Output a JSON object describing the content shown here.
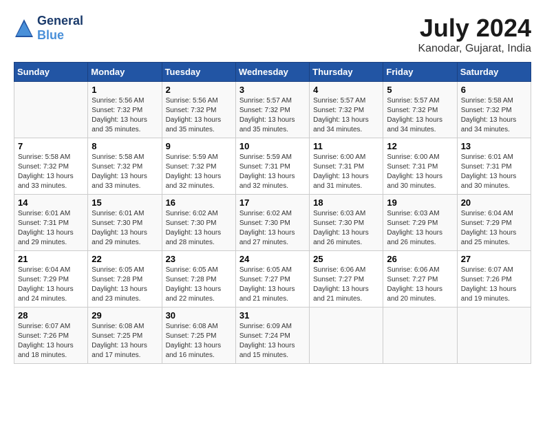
{
  "header": {
    "logo_line1": "General",
    "logo_line2": "Blue",
    "month_year": "July 2024",
    "location": "Kanodar, Gujarat, India"
  },
  "weekdays": [
    "Sunday",
    "Monday",
    "Tuesday",
    "Wednesday",
    "Thursday",
    "Friday",
    "Saturday"
  ],
  "weeks": [
    [
      {
        "day": "",
        "sunrise": "",
        "sunset": "",
        "daylight": ""
      },
      {
        "day": "1",
        "sunrise": "5:56 AM",
        "sunset": "7:32 PM",
        "daylight": "13 hours and 35 minutes."
      },
      {
        "day": "2",
        "sunrise": "5:56 AM",
        "sunset": "7:32 PM",
        "daylight": "13 hours and 35 minutes."
      },
      {
        "day": "3",
        "sunrise": "5:57 AM",
        "sunset": "7:32 PM",
        "daylight": "13 hours and 35 minutes."
      },
      {
        "day": "4",
        "sunrise": "5:57 AM",
        "sunset": "7:32 PM",
        "daylight": "13 hours and 34 minutes."
      },
      {
        "day": "5",
        "sunrise": "5:57 AM",
        "sunset": "7:32 PM",
        "daylight": "13 hours and 34 minutes."
      },
      {
        "day": "6",
        "sunrise": "5:58 AM",
        "sunset": "7:32 PM",
        "daylight": "13 hours and 34 minutes."
      }
    ],
    [
      {
        "day": "7",
        "sunrise": "5:58 AM",
        "sunset": "7:32 PM",
        "daylight": "13 hours and 33 minutes."
      },
      {
        "day": "8",
        "sunrise": "5:58 AM",
        "sunset": "7:32 PM",
        "daylight": "13 hours and 33 minutes."
      },
      {
        "day": "9",
        "sunrise": "5:59 AM",
        "sunset": "7:32 PM",
        "daylight": "13 hours and 32 minutes."
      },
      {
        "day": "10",
        "sunrise": "5:59 AM",
        "sunset": "7:31 PM",
        "daylight": "13 hours and 32 minutes."
      },
      {
        "day": "11",
        "sunrise": "6:00 AM",
        "sunset": "7:31 PM",
        "daylight": "13 hours and 31 minutes."
      },
      {
        "day": "12",
        "sunrise": "6:00 AM",
        "sunset": "7:31 PM",
        "daylight": "13 hours and 30 minutes."
      },
      {
        "day": "13",
        "sunrise": "6:01 AM",
        "sunset": "7:31 PM",
        "daylight": "13 hours and 30 minutes."
      }
    ],
    [
      {
        "day": "14",
        "sunrise": "6:01 AM",
        "sunset": "7:31 PM",
        "daylight": "13 hours and 29 minutes."
      },
      {
        "day": "15",
        "sunrise": "6:01 AM",
        "sunset": "7:30 PM",
        "daylight": "13 hours and 29 minutes."
      },
      {
        "day": "16",
        "sunrise": "6:02 AM",
        "sunset": "7:30 PM",
        "daylight": "13 hours and 28 minutes."
      },
      {
        "day": "17",
        "sunrise": "6:02 AM",
        "sunset": "7:30 PM",
        "daylight": "13 hours and 27 minutes."
      },
      {
        "day": "18",
        "sunrise": "6:03 AM",
        "sunset": "7:30 PM",
        "daylight": "13 hours and 26 minutes."
      },
      {
        "day": "19",
        "sunrise": "6:03 AM",
        "sunset": "7:29 PM",
        "daylight": "13 hours and 26 minutes."
      },
      {
        "day": "20",
        "sunrise": "6:04 AM",
        "sunset": "7:29 PM",
        "daylight": "13 hours and 25 minutes."
      }
    ],
    [
      {
        "day": "21",
        "sunrise": "6:04 AM",
        "sunset": "7:29 PM",
        "daylight": "13 hours and 24 minutes."
      },
      {
        "day": "22",
        "sunrise": "6:05 AM",
        "sunset": "7:28 PM",
        "daylight": "13 hours and 23 minutes."
      },
      {
        "day": "23",
        "sunrise": "6:05 AM",
        "sunset": "7:28 PM",
        "daylight": "13 hours and 22 minutes."
      },
      {
        "day": "24",
        "sunrise": "6:05 AM",
        "sunset": "7:27 PM",
        "daylight": "13 hours and 21 minutes."
      },
      {
        "day": "25",
        "sunrise": "6:06 AM",
        "sunset": "7:27 PM",
        "daylight": "13 hours and 21 minutes."
      },
      {
        "day": "26",
        "sunrise": "6:06 AM",
        "sunset": "7:27 PM",
        "daylight": "13 hours and 20 minutes."
      },
      {
        "day": "27",
        "sunrise": "6:07 AM",
        "sunset": "7:26 PM",
        "daylight": "13 hours and 19 minutes."
      }
    ],
    [
      {
        "day": "28",
        "sunrise": "6:07 AM",
        "sunset": "7:26 PM",
        "daylight": "13 hours and 18 minutes."
      },
      {
        "day": "29",
        "sunrise": "6:08 AM",
        "sunset": "7:25 PM",
        "daylight": "13 hours and 17 minutes."
      },
      {
        "day": "30",
        "sunrise": "6:08 AM",
        "sunset": "7:25 PM",
        "daylight": "13 hours and 16 minutes."
      },
      {
        "day": "31",
        "sunrise": "6:09 AM",
        "sunset": "7:24 PM",
        "daylight": "13 hours and 15 minutes."
      },
      {
        "day": "",
        "sunrise": "",
        "sunset": "",
        "daylight": ""
      },
      {
        "day": "",
        "sunrise": "",
        "sunset": "",
        "daylight": ""
      },
      {
        "day": "",
        "sunrise": "",
        "sunset": "",
        "daylight": ""
      }
    ]
  ]
}
